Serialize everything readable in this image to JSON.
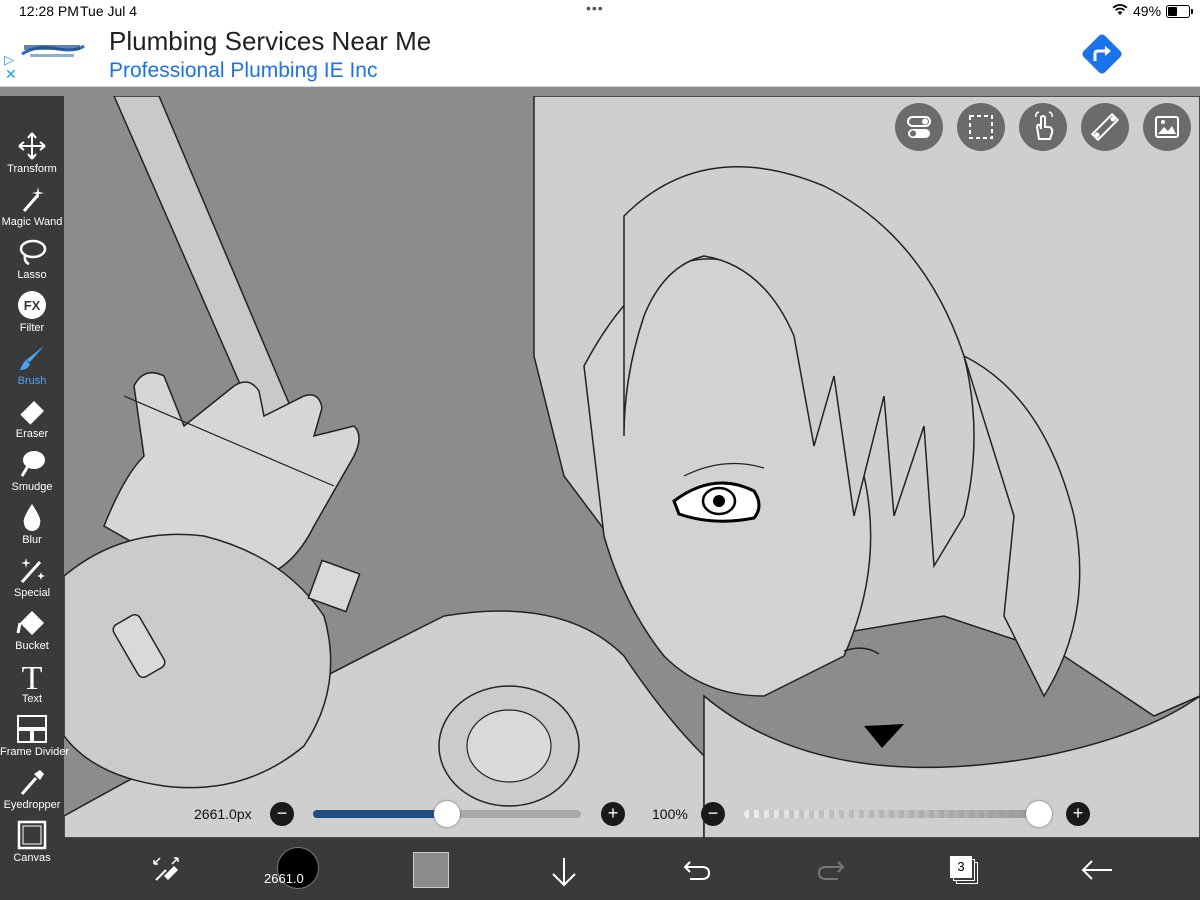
{
  "status_bar": {
    "time": "12:28 PM",
    "date": "Tue Jul 4",
    "battery": "49%"
  },
  "ad": {
    "title": "Plumbing Services Near Me",
    "subtitle": "Professional Plumbing IE Inc",
    "close": "✕",
    "adchoices": "▷"
  },
  "tools": [
    {
      "label": "Transform",
      "icon": "transform-icon"
    },
    {
      "label": "Magic Wand",
      "icon": "magic-wand-icon"
    },
    {
      "label": "Lasso",
      "icon": "lasso-icon"
    },
    {
      "label": "Filter",
      "icon": "filter-fx-icon",
      "glyph": "FX"
    },
    {
      "label": "Brush",
      "icon": "brush-icon",
      "active": true
    },
    {
      "label": "Eraser",
      "icon": "eraser-icon"
    },
    {
      "label": "Smudge",
      "icon": "smudge-icon"
    },
    {
      "label": "Blur",
      "icon": "blur-icon"
    },
    {
      "label": "Special",
      "icon": "special-icon"
    },
    {
      "label": "Bucket",
      "icon": "bucket-icon"
    },
    {
      "label": "Text",
      "icon": "text-icon",
      "glyph": "T"
    },
    {
      "label": "Frame Divider",
      "icon": "frame-divider-icon"
    },
    {
      "label": "Eyedropper",
      "icon": "eyedropper-icon"
    },
    {
      "label": "Canvas",
      "icon": "canvas-icon"
    }
  ],
  "top_icons": [
    "toggle-icon",
    "selection-icon",
    "touch-icon",
    "ruler-icon",
    "image-icon"
  ],
  "brush_size": {
    "label": "2661.0px",
    "value": 0.5
  },
  "opacity": {
    "label": "100%",
    "value": 1.0
  },
  "bottom": {
    "brush_preview_label": "2661.0",
    "layers_count": "3"
  },
  "colors": {
    "accent": "#4aa3f0",
    "toolbar_bg": "#3a3a3a",
    "canvas_bg": "#8c8c8c",
    "current_color": "#8c8c8c",
    "size_track": "#1e4e86"
  }
}
